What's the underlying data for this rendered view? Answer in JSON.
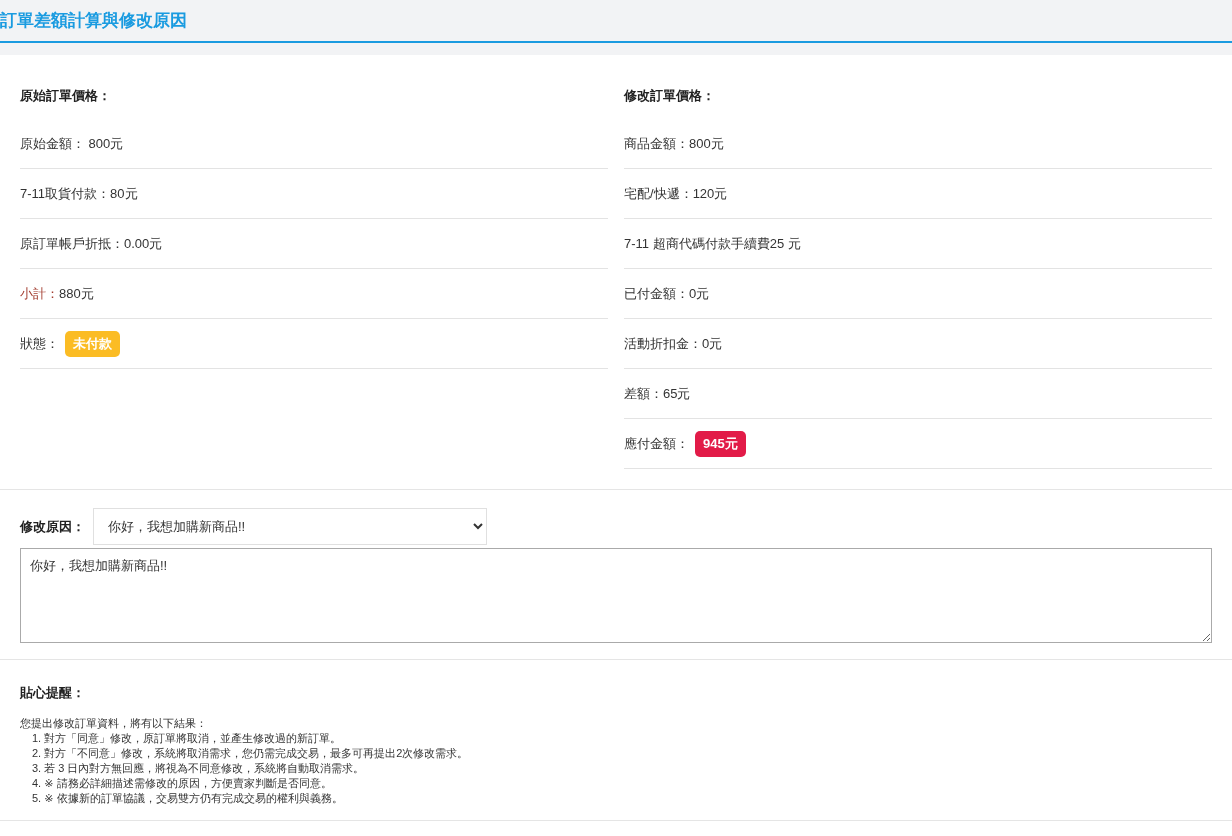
{
  "header": {
    "title": "訂單差額計算與修改原因"
  },
  "original": {
    "heading": "原始訂單價格：",
    "rows": [
      {
        "kind": "text",
        "label": "原始金額：",
        "value": " 800元"
      },
      {
        "kind": "text",
        "label": "7-11取貨付款：",
        "value": "80元"
      },
      {
        "kind": "text",
        "label": "原訂單帳戶折抵：",
        "value": "0.00元"
      },
      {
        "kind": "subtotal",
        "label": "小計：",
        "value": "880元"
      },
      {
        "kind": "badge",
        "label": "狀態：",
        "value": "未付款",
        "color": "#fbbc24"
      }
    ]
  },
  "modified": {
    "heading": "修改訂單價格：",
    "rows": [
      {
        "kind": "text",
        "label": "商品金額：",
        "value": "800元"
      },
      {
        "kind": "text",
        "label": "宅配/快遞：",
        "value": "120元"
      },
      {
        "kind": "text",
        "label": "7-11 超商代碼付款手續費",
        "value": "25 元"
      },
      {
        "kind": "text",
        "label": "已付金額：",
        "value": "0元"
      },
      {
        "kind": "text",
        "label": "活動折扣金：",
        "value": "0元"
      },
      {
        "kind": "text",
        "label": "差額：",
        "value": "65元"
      },
      {
        "kind": "badge",
        "label": "應付金額：",
        "value": "945元",
        "color": "#e21b48"
      }
    ]
  },
  "reason": {
    "label": "修改原因：",
    "selected_option": "你好，我想加購新商品!!",
    "text": "你好，我想加購新商品!!"
  },
  "notes": {
    "heading": "貼心提醒：",
    "intro": "您提出修改訂單資料，將有以下結果：",
    "items": [
      "1. 對方「同意」修改，原訂單將取消，並產生修改過的新訂單。",
      "2. 對方「不同意」修改，系統將取消需求，您仍需完成交易，最多可再提出2次修改需求。",
      "3. 若 3 日內對方無回應，將視為不同意修改，系統將自動取消需求。",
      "4. ※ 請務必詳細描述需修改的原因，方便賣家判斷是否同意。",
      "5. ※ 依據新的訂單協議，交易雙方仍有完成交易的權利與義務。"
    ]
  }
}
